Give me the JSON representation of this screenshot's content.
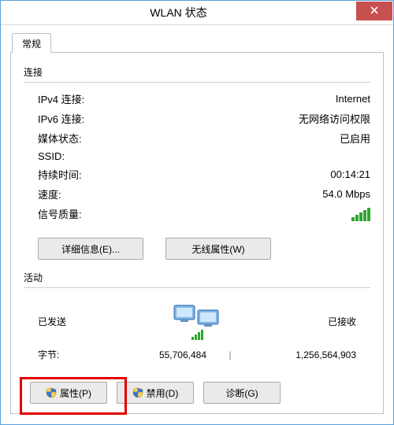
{
  "window": {
    "title": "WLAN 状态"
  },
  "tabs": {
    "general": "常规"
  },
  "groups": {
    "connection": "连接",
    "activity": "活动"
  },
  "connection": {
    "ipv4_label": "IPv4 连接:",
    "ipv4_value": "Internet",
    "ipv6_label": "IPv6 连接:",
    "ipv6_value": "无网络访问权限",
    "media_label": "媒体状态:",
    "media_value": "已启用",
    "ssid_label": "SSID:",
    "ssid_value": "",
    "duration_label": "持续时间:",
    "duration_value": "00:14:21",
    "speed_label": "速度:",
    "speed_value": "54.0 Mbps",
    "signal_label": "信号质量:"
  },
  "buttons": {
    "details": "详细信息(E)...",
    "wireless_props": "无线属性(W)",
    "properties": "属性(P)",
    "disable": "禁用(D)",
    "diagnose": "诊断(G)"
  },
  "activity": {
    "sent_label": "已发送",
    "recv_label": "已接收",
    "bytes_label": "字节:",
    "sent_value": "55,706,484",
    "recv_value": "1,256,564,903"
  },
  "icons": {
    "close": "close-icon",
    "signal": "signal-bars-icon",
    "shield": "uac-shield-icon",
    "computers": "network-computers-icon"
  }
}
